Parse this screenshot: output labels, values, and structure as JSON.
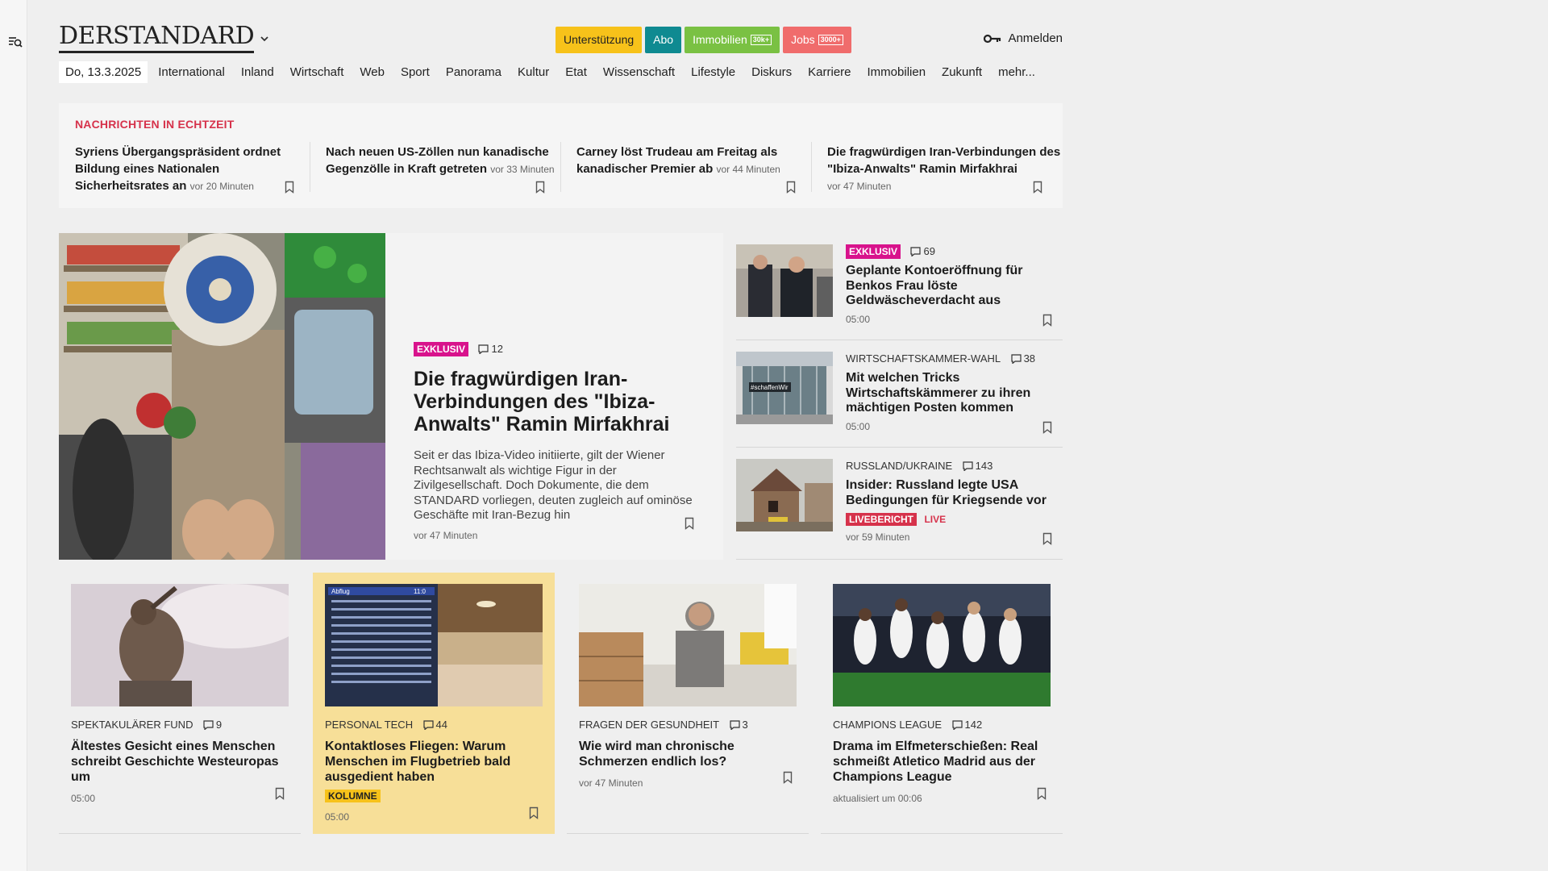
{
  "header": {
    "logo": "DERSTANDARD",
    "promo": [
      {
        "label": "Unterstützung",
        "tag": ""
      },
      {
        "label": "Abo",
        "tag": ""
      },
      {
        "label": "Immobilien",
        "tag": "30k+"
      },
      {
        "label": "Jobs",
        "tag": "3000+"
      }
    ],
    "login": "Anmelden"
  },
  "nav": {
    "date": "Do, 13.3.2025",
    "items": [
      "International",
      "Inland",
      "Wirtschaft",
      "Web",
      "Sport",
      "Panorama",
      "Kultur",
      "Etat",
      "Wissenschaft",
      "Lifestyle",
      "Diskurs",
      "Karriere",
      "Immobilien",
      "Zukunft",
      "mehr..."
    ]
  },
  "ticker": {
    "heading": "NACHRICHTEN IN ECHTZEIT",
    "items": [
      {
        "title": "Syriens Übergangspräsident ordnet Bildung eines Nationalen Sicherheitsrates an",
        "time": "vor 20 Minuten"
      },
      {
        "title": "Nach neuen US-Zöllen nun kanadische Gegenzölle in Kraft getreten",
        "time": "vor 33 Minuten"
      },
      {
        "title": "Carney löst Trudeau am Freitag als kanadischer Premier ab",
        "time": "vor 44 Minuten"
      },
      {
        "title": "Die fragwürdigen Iran-Verbindungen des \"Ibiza-Anwalts\" Ramin Mirfakhrai",
        "time": "vor 47 Minuten"
      }
    ]
  },
  "hero": {
    "badge": "EXKLUSIV",
    "comments": "12",
    "title": "Die fragwürdigen Iran-Verbindungen des \"Ibiza-Anwalts\" Ramin Mirfakhrai",
    "lead": "Seit er das Ibiza-Video initiierte, gilt der Wiener Rechtsanwalt als wichtige Figur in der Zivilgesellschaft. Doch Dokumente, die dem STANDARD vorliegen, deuten zugleich auf ominöse Geschäfte mit Iran-Bezug hin",
    "time": "vor 47 Minuten"
  },
  "side": [
    {
      "badge": "EXKLUSIV",
      "kicker": "",
      "comments": "69",
      "title": "Geplante Kontoeröffnung für Benkos Frau löste Geldwäscheverdacht aus",
      "time": "05:00"
    },
    {
      "badge": "",
      "kicker": "WIRTSCHAFTSKAMMER-WAHL",
      "comments": "38",
      "title": "Mit welchen Tricks Wirtschaftskämmerer zu ihren mächtigen Posten kommen",
      "time": "05:00"
    },
    {
      "badge": "",
      "kicker": "RUSSLAND/UKRAINE",
      "comments": "143",
      "title": "Insider: Russland legte USA Bedingungen für Kriegsende vor",
      "live_badge": "LIVEBERICHT",
      "live_text": "LIVE",
      "time": "vor 59 Minuten"
    }
  ],
  "cards": [
    {
      "kicker": "SPEKTAKULÄRER FUND",
      "comments": "9",
      "title": "Ältestes Gesicht eines Menschen schreibt Geschichte Westeuropas um",
      "time": "05:00"
    },
    {
      "kicker": "PERSONAL TECH",
      "comments": "44",
      "title": "Kontaktloses Fliegen: Warum Menschen im Flugbetrieb bald ausgedient haben",
      "label": "KOLUMNE",
      "time": "05:00",
      "board_title": "Abflug",
      "board_time": "11:0"
    },
    {
      "kicker": "FRAGEN DER GESUNDHEIT",
      "comments": "3",
      "title": "Wie wird man chronische Schmerzen endlich los?",
      "time": "vor 47 Minuten"
    },
    {
      "kicker": "CHAMPIONS LEAGUE",
      "comments": "142",
      "title": "Drama im Elfmeterschießen: Real schmeißt Atletico Madrid aus der Champions League",
      "time": "aktualisiert um 00:06"
    }
  ],
  "image_texts": {
    "wko_sign": "#schaffenWir"
  },
  "colors": {
    "accent_red": "#d6324b",
    "exklusiv": "#d8138c",
    "highlight_card": "#f7df98"
  }
}
